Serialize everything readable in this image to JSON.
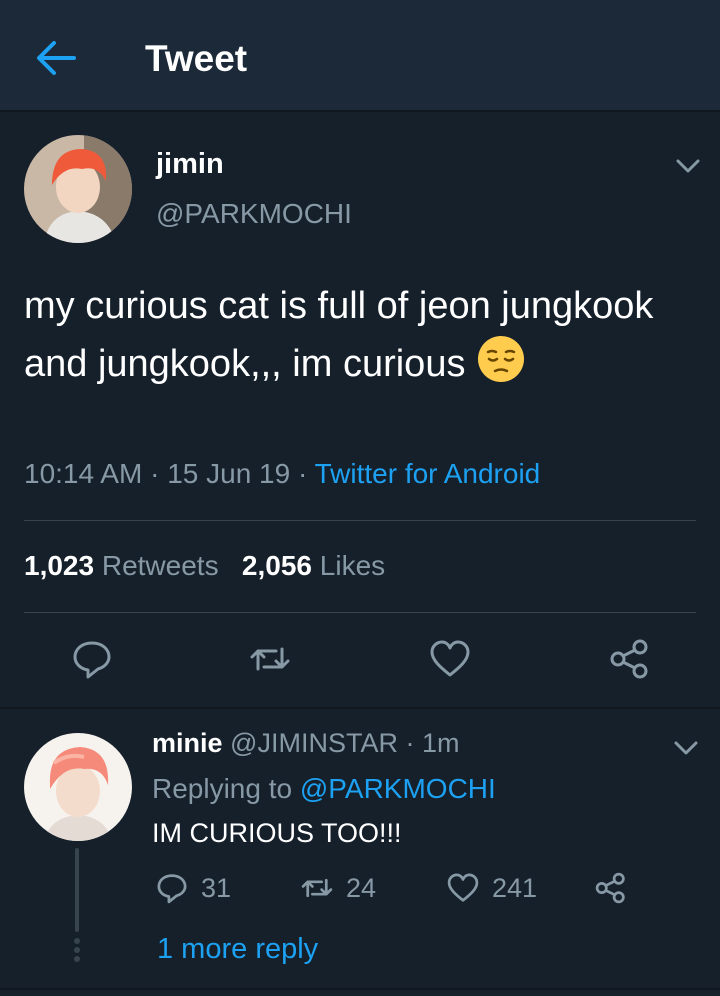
{
  "header": {
    "title": "Tweet",
    "back_icon": "arrow-left-icon"
  },
  "tweet": {
    "name": "jimin",
    "handle": "@PARKMOCHI",
    "text": "my curious cat is full of jeon jungkook and jungkook,,, im curious",
    "emoji": "pensive-face-emoji",
    "time": "10:14 AM",
    "date": "15 Jun 19",
    "source": "Twitter for Android",
    "retweets_count": "1,023",
    "retweets_label": "Retweets",
    "likes_count": "2,056",
    "likes_label": "Likes"
  },
  "reply": {
    "name": "minie",
    "handle": "@JIMINSTAR",
    "age": "1m",
    "replying_prefix": "Replying to",
    "replying_to": "@PARKMOCHI",
    "text": "IM CURIOUS TOO!!!",
    "replies": "31",
    "retweets": "24",
    "likes": "241",
    "more_replies": "1 more reply"
  },
  "colors": {
    "background": "#15202b",
    "header": "#1c2938",
    "accent": "#1da1f2",
    "muted": "#8899a6",
    "divider": "#38444d"
  }
}
